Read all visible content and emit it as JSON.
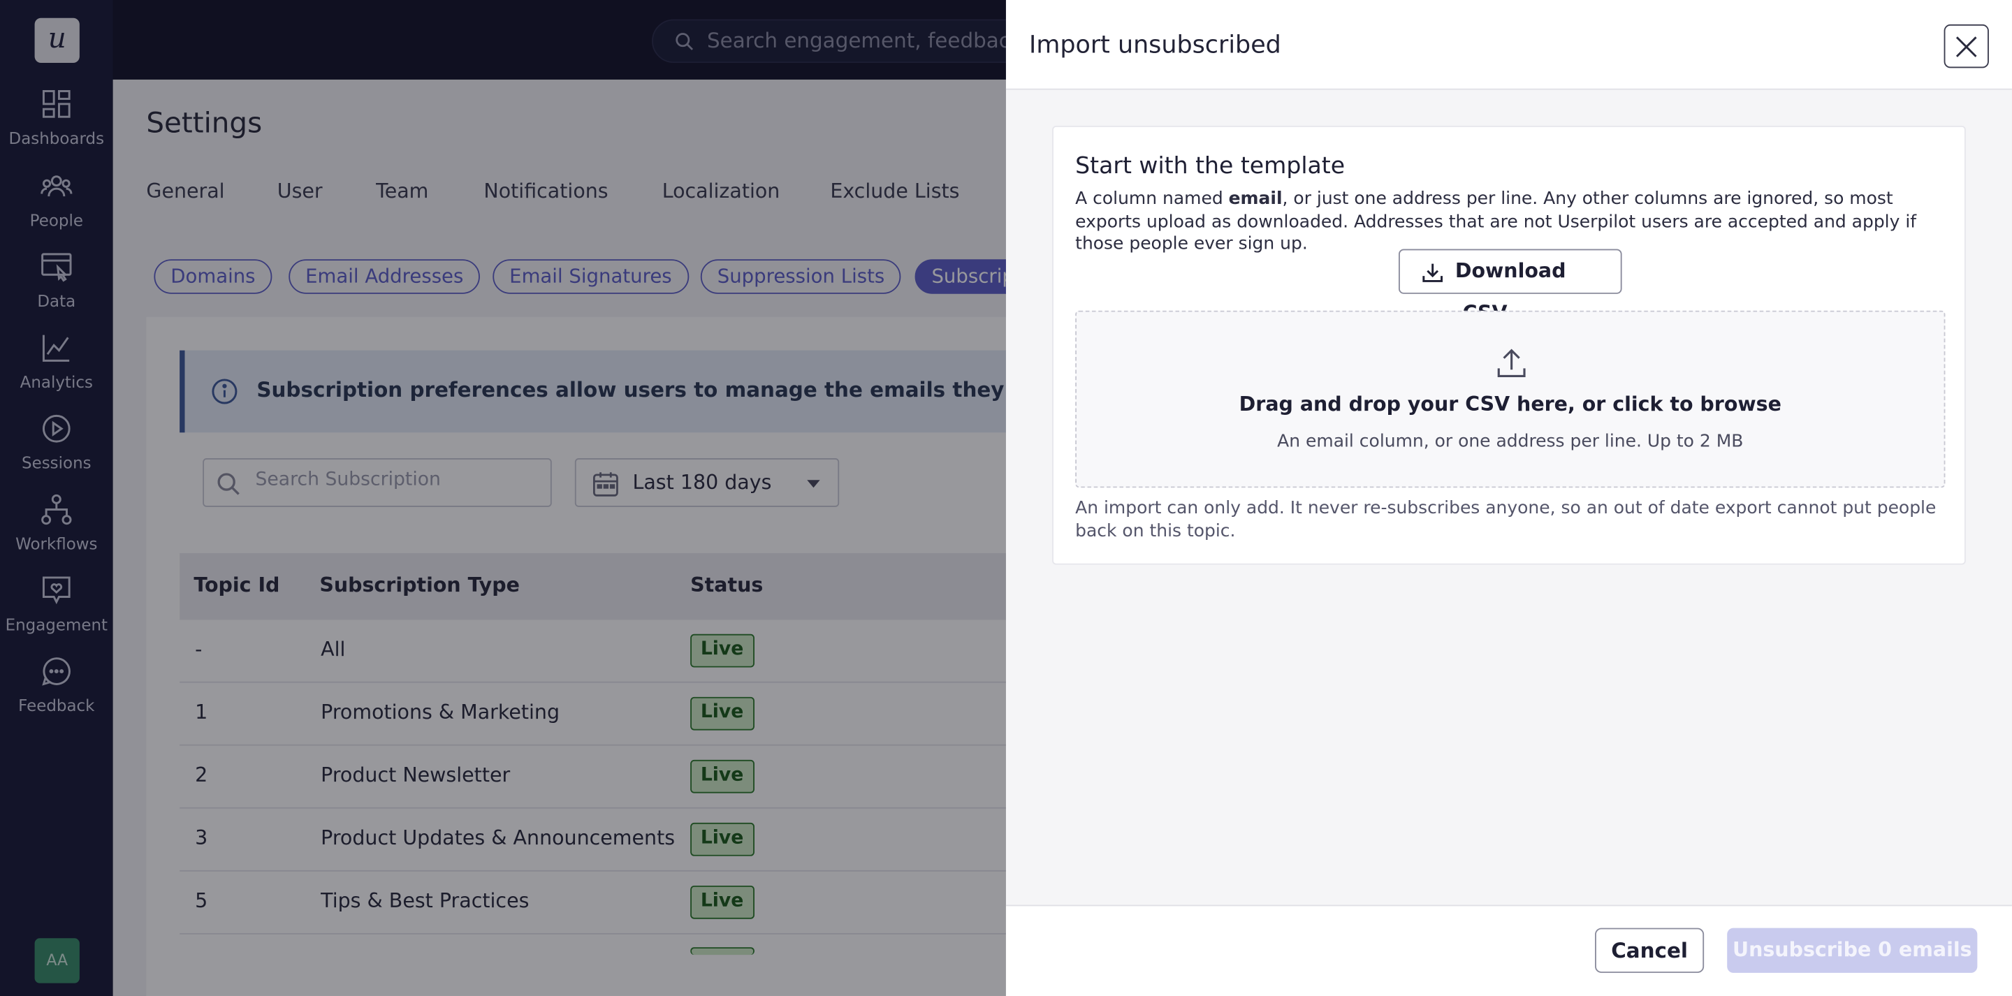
{
  "app": {
    "logo_text": "u",
    "avatar_initials": "AA"
  },
  "sidebar": {
    "items": [
      {
        "label": "Dashboards",
        "icon": "dashboard-icon"
      },
      {
        "label": "People",
        "icon": "people-icon"
      },
      {
        "label": "Data",
        "icon": "data-icon"
      },
      {
        "label": "Analytics",
        "icon": "analytics-icon"
      },
      {
        "label": "Sessions",
        "icon": "sessions-icon"
      },
      {
        "label": "Workflows",
        "icon": "workflows-icon"
      },
      {
        "label": "Engagement",
        "icon": "engagement-icon"
      },
      {
        "label": "Feedback",
        "icon": "feedback-icon"
      }
    ]
  },
  "topbar": {
    "search_placeholder": "Search engagement, feedback, re"
  },
  "settings": {
    "title": "Settings",
    "tabs": [
      "General",
      "User",
      "Team",
      "Notifications",
      "Localization",
      "Exclude Lists"
    ],
    "pills": [
      "Domains",
      "Email Addresses",
      "Email Signatures",
      "Suppression Lists",
      "Subscrip"
    ],
    "active_pill": "Subscrip",
    "banner_text": "Subscription preferences allow users to manage the emails they receive, ensuri",
    "search_placeholder": "Search Subscription",
    "date_range": "Last 180 days",
    "table": {
      "headers": [
        "Topic Id",
        "Subscription Type",
        "Status"
      ],
      "rows": [
        {
          "id": "-",
          "type": "All",
          "status": "Live"
        },
        {
          "id": "1",
          "type": "Promotions & Marketing",
          "status": "Live"
        },
        {
          "id": "2",
          "type": "Product Newsletter",
          "status": "Live"
        },
        {
          "id": "3",
          "type": "Product Updates & Announcements",
          "status": "Live"
        },
        {
          "id": "5",
          "type": "Tips & Best Practices",
          "status": "Live"
        }
      ]
    }
  },
  "drawer": {
    "title": "Import unsubscribed",
    "template_title": "Start with the template",
    "desc_prefix": "A column named ",
    "desc_bold": "email",
    "desc_suffix": ", or just one address per line. Any other columns are ignored, so most exports upload as downloaded. Addresses that are not Userpilot users are accepted and apply if those people ever sign up.",
    "download_label": "Download .CSV",
    "dropzone_main": "Drag and drop your CSV here, or click to browse",
    "dropzone_sub": "An email column, or one address per line. Up to 2 MB",
    "note": "An import can only add. It never re-subscribes anyone, so an out of date export cannot put people back on this topic.",
    "cancel_label": "Cancel",
    "submit_label": "Unsubscribe 0 emails"
  },
  "colors": {
    "accent": "#5e60c8",
    "sidebar_bg": "#1a1c3a",
    "live_badge": "#cfeac7",
    "disabled_button": "#c9cbee"
  }
}
